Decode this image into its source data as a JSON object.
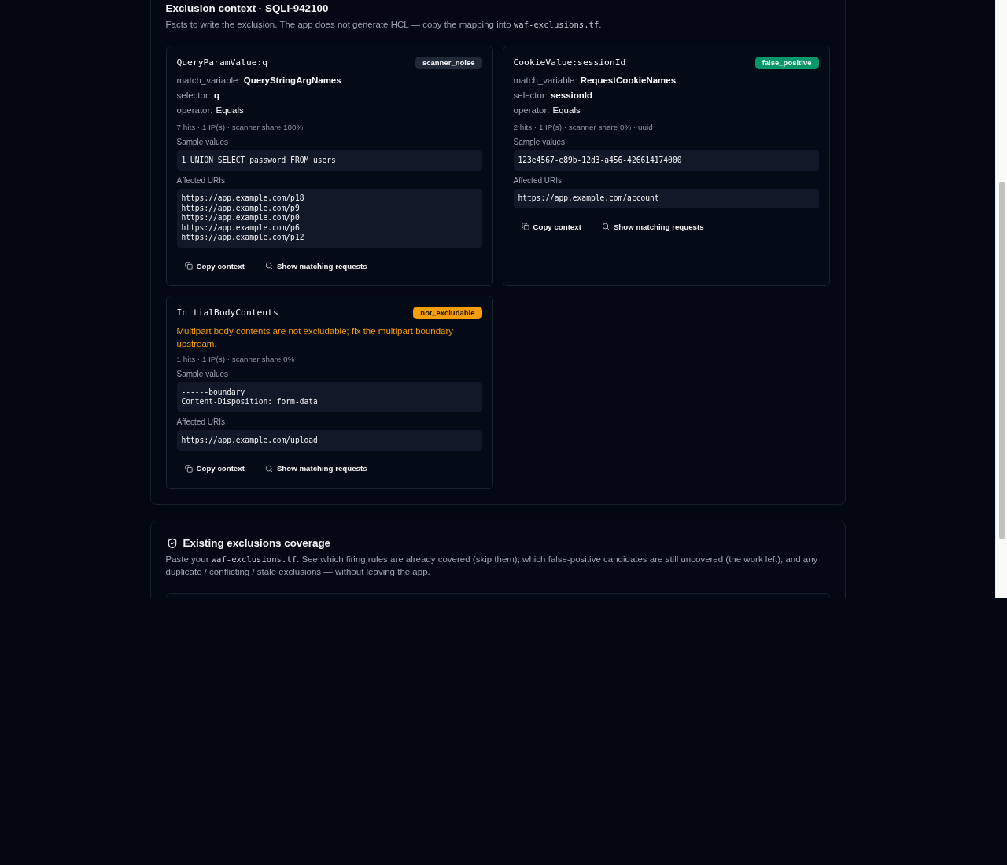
{
  "exclusion_context": {
    "title": "Exclusion context · SQLI-942100",
    "description": [
      {
        "text": "Facts to write the exclusion. The app does not generate HCL — copy the mapping into ",
        "code": false
      },
      {
        "text": "waf-exclusions.tf",
        "code": true
      },
      {
        "text": ".",
        "code": false
      }
    ],
    "cards": [
      {
        "title": "QueryParamValue:q",
        "tag": {
          "label": "scanner_noise",
          "color": "#1f2937"
        },
        "fields": [
          {
            "name": "match_variable:",
            "value": "QueryStringArgNames",
            "strong": true
          },
          {
            "name": "selector:",
            "value": "q",
            "strong": true
          },
          {
            "name": "operator:",
            "value": "Equals",
            "strong": false
          }
        ],
        "stats": "7 hits · 1 IP(s) · scanner share 100%",
        "sample_values_label": "Sample values",
        "sample_values": [
          "1 UNION SELECT password FROM users"
        ],
        "affected_uris_label": "Affected URIs",
        "affected_uris": [
          "https://app.example.com/p18",
          "https://app.example.com/p9",
          "https://app.example.com/p0",
          "https://app.example.com/p6",
          "https://app.example.com/p12"
        ],
        "actions": [
          {
            "label": "Copy context",
            "kind": "copy"
          },
          {
            "label": "Show matching requests",
            "kind": "search"
          }
        ]
      },
      {
        "title": "CookieValue:sessionId",
        "tag": {
          "label": "false_positive",
          "color": "#059669"
        },
        "fields": [
          {
            "name": "match_variable:",
            "value": "RequestCookieNames",
            "strong": true
          },
          {
            "name": "selector:",
            "value": "sessionId",
            "strong": true
          },
          {
            "name": "operator:",
            "value": "Equals",
            "strong": false
          }
        ],
        "stats": "2 hits · 1 IP(s) · scanner share 0% · uuid",
        "sample_values_label": "Sample values",
        "sample_values": [
          "123e4567-e89b-12d3-a456-426614174000"
        ],
        "affected_uris_label": "Affected URIs",
        "affected_uris": [
          "https://app.example.com/account"
        ],
        "actions": [
          {
            "label": "Copy context",
            "kind": "copy"
          },
          {
            "label": "Show matching requests",
            "kind": "search"
          }
        ]
      },
      {
        "title": "InitialBodyContents",
        "tag": {
          "label": "not_excludable",
          "color": "#f59e0b"
        },
        "note": "Multipart body contents are not excludable; fix the multipart boundary upstream.",
        "stats": "1 hits · 1 IP(s) · scanner share 0%",
        "sample_values_label": "Sample values",
        "sample_values": [
          "------boundary",
          "Content-Disposition: form-data"
        ],
        "affected_uris_label": "Affected URIs",
        "affected_uris": [
          "https://app.example.com/upload"
        ],
        "actions": [
          {
            "label": "Copy context",
            "kind": "copy"
          },
          {
            "label": "Show matching requests",
            "kind": "search"
          }
        ]
      }
    ]
  },
  "coverage": {
    "title": "Existing exclusions coverage",
    "description": [
      {
        "text": "Paste your ",
        "code": false
      },
      {
        "text": "waf-exclusions.tf",
        "code": true
      },
      {
        "text": ". See which firing rules are already covered (skip them), which false-positive candidates are still uncovered (the work left), and any duplicate / conflicting / stale exclusions — without leaving the app.",
        "code": false
      }
    ]
  }
}
